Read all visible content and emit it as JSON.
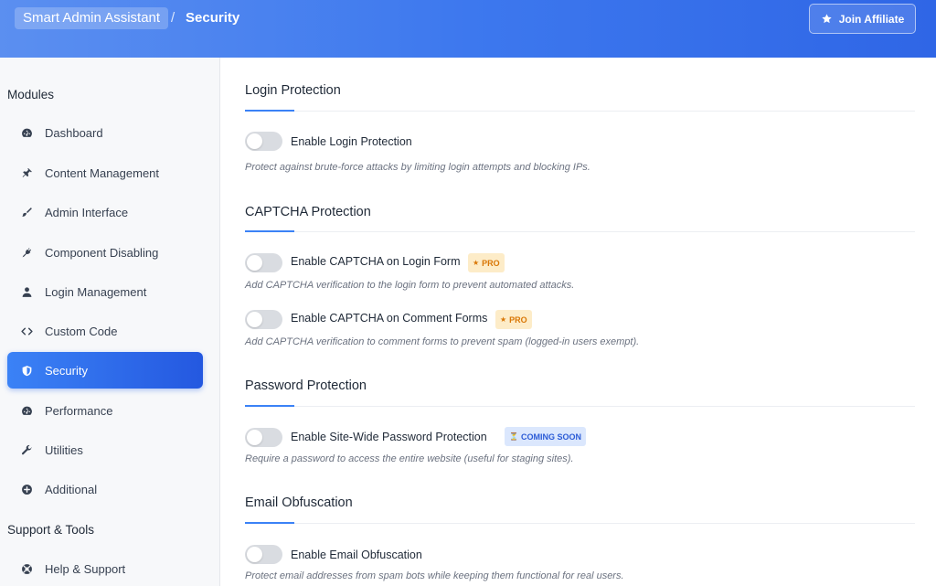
{
  "header": {
    "app_name": "Smart Admin Assistant",
    "separator": "/",
    "page_title": "Security",
    "affiliate_label": "Join Affiliate",
    "affiliate_icon": "star-icon"
  },
  "sidebar": {
    "modules_title": "Modules",
    "support_title": "Support & Tools",
    "items": [
      {
        "label": "Dashboard",
        "icon": "gauge-icon"
      },
      {
        "label": "Content Management",
        "icon": "pin-icon"
      },
      {
        "label": "Admin Interface",
        "icon": "brush-icon"
      },
      {
        "label": "Component Disabling",
        "icon": "plug-icon"
      },
      {
        "label": "Login Management",
        "icon": "user-icon"
      },
      {
        "label": "Custom Code",
        "icon": "code-icon"
      },
      {
        "label": "Security",
        "icon": "shield-icon",
        "active": true
      },
      {
        "label": "Performance",
        "icon": "gauge-icon"
      },
      {
        "label": "Utilities",
        "icon": "wrench-icon"
      },
      {
        "label": "Additional",
        "icon": "plus-circle-icon"
      }
    ],
    "support_items": [
      {
        "label": "Help & Support",
        "icon": "lifebuoy-icon"
      }
    ]
  },
  "sections": [
    {
      "title": "Login Protection",
      "options": [
        {
          "label": "Enable Login Protection",
          "enabled": false,
          "description": "Protect against brute-force attacks by limiting login attempts and blocking IPs."
        }
      ]
    },
    {
      "title": "CAPTCHA Protection",
      "options": [
        {
          "label": "Enable CAPTCHA on Login Form",
          "enabled": false,
          "badge": "PRO",
          "badge_icon": "star-icon",
          "description": "Add CAPTCHA verification to the login form to prevent automated attacks."
        },
        {
          "label": "Enable CAPTCHA on Comment Forms",
          "enabled": false,
          "badge": "PRO",
          "badge_icon": "star-icon",
          "description": "Add CAPTCHA verification to comment forms to prevent spam (logged-in users exempt)."
        }
      ]
    },
    {
      "title": "Password Protection",
      "options": [
        {
          "label": "Enable Site-Wide Password Protection",
          "enabled": false,
          "badge": "COMING SOON",
          "badge_icon": "hourglass-icon",
          "description": "Require a password to access the entire website (useful for staging sites)."
        }
      ]
    },
    {
      "title": "Email Obfuscation",
      "options": [
        {
          "label": "Enable Email Obfuscation",
          "enabled": false,
          "description": "Protect email addresses from spam bots while keeping them functional for real users."
        }
      ]
    }
  ],
  "colors": {
    "header_gradient_start": "#5b8ff0",
    "header_gradient_end": "#2f66e6",
    "active_nav": "#2f6ae8",
    "accent": "#3b82f6",
    "pro_badge_bg": "#fdecc8",
    "pro_badge_text": "#d97706",
    "soon_badge_bg": "#dbe7fd",
    "soon_badge_text": "#2b5bd6",
    "toggle_off": "#d9dce1"
  }
}
